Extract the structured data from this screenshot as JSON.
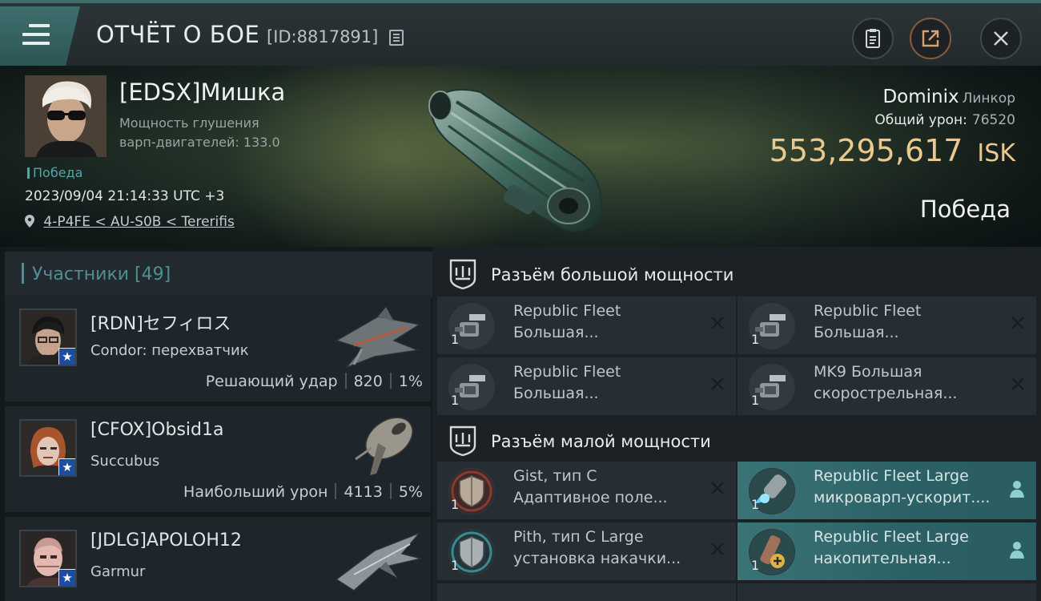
{
  "header": {
    "title": "ОТЧЁТ О БОЕ",
    "battle_id": "[ID:8817891]"
  },
  "hero": {
    "pilot_name": "[EDSX]Мишка",
    "jam_line1": "Мощность глушения",
    "jam_line2": "варп-двигателей: 133.0",
    "result_tag": "Победа",
    "datetime": "2023/09/04 21:14:33 UTC +3",
    "location": "4-P4FE < AU-S0B < Tererifis",
    "ship_name": "Dominix",
    "ship_class": "Линкор",
    "damage_label": "Общий урон:",
    "damage_value": "76520",
    "isk_value": "553,295,617",
    "isk_unit": "ISK",
    "result_big": "Победа"
  },
  "participants": {
    "header": "Участники [49]",
    "rows": [
      {
        "name": "[RDN]セフィロス",
        "ship": "Condor: перехватчик",
        "role": "Решающий удар",
        "damage": "820",
        "percent": "1%"
      },
      {
        "name": "[CFOX]Obsid1a",
        "ship": "Succubus",
        "role": "Наибольший урон",
        "damage": "4113",
        "percent": "5%"
      },
      {
        "name": "[JDLG]APOLOH12",
        "ship": "Garmur"
      }
    ]
  },
  "modules": {
    "high_title": "Разъём большой мощности",
    "low_title": "Разъём малой мощности",
    "high": [
      {
        "qty": "1",
        "line1": "Republic Fleet",
        "line2": "Большая..."
      },
      {
        "qty": "1",
        "line1": "Republic Fleet",
        "line2": "Большая..."
      },
      {
        "qty": "1",
        "line1": "Republic Fleet",
        "line2": "Большая..."
      },
      {
        "qty": "1",
        "line1": "MK9 Большая",
        "line2": "скорострельная..."
      }
    ],
    "low": [
      {
        "qty": "1",
        "line1": "Gist, тип C",
        "line2": "Адаптивное поле..."
      },
      {
        "qty": "1",
        "line1": "Republic Fleet Large",
        "line2": "микроварп-ускорит...."
      },
      {
        "qty": "1",
        "line1": "Pith, тип C Large",
        "line2": "установка накачки..."
      },
      {
        "qty": "1",
        "line1": "Republic Fleet Large",
        "line2": "накопительная..."
      }
    ]
  },
  "colors": {
    "accent_teal": "#3f6f6d",
    "isk_gold": "#e9c98e",
    "active_module": "#3a7477"
  }
}
